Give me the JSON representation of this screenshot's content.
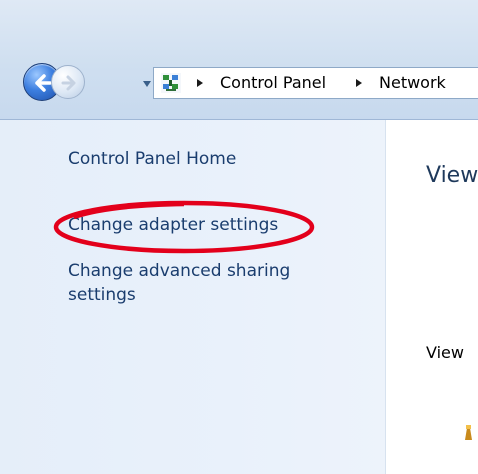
{
  "breadcrumb": {
    "items": [
      "Control Panel",
      "Network"
    ]
  },
  "left_nav": {
    "home": "Control Panel Home",
    "adapter": "Change adapter settings",
    "advanced_line1": "Change advanced sharing",
    "advanced_line2": "settings"
  },
  "content": {
    "heading": "View",
    "subheading": "View"
  },
  "colors": {
    "link": "#1a3d6e",
    "annotation": "#e3001b"
  },
  "icons": {
    "back": "back-arrow-icon",
    "forward": "forward-arrow-icon",
    "recent": "dropdown-arrow-icon",
    "control_panel": "control-panel-icon",
    "separator": "chevron-right-icon"
  }
}
